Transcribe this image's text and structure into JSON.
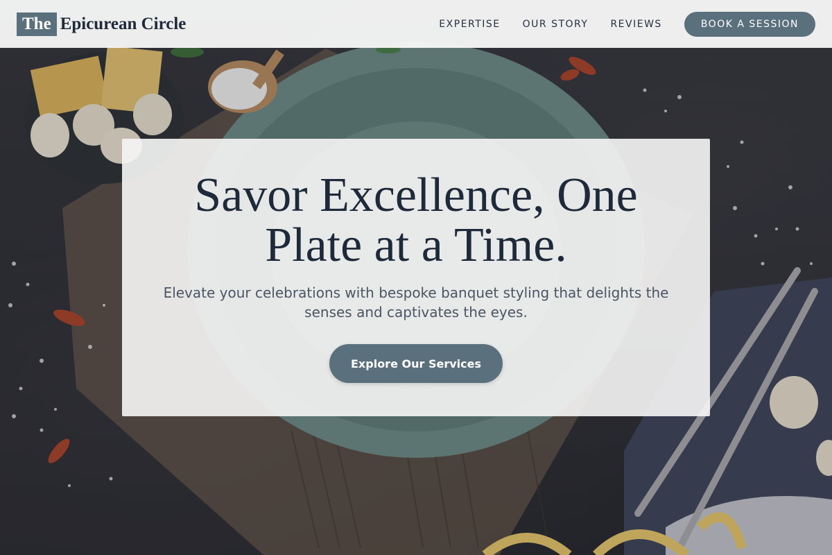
{
  "header": {
    "logo_mark": "The",
    "logo_text": "Epicurean Circle",
    "nav": [
      {
        "label": "EXPERTISE"
      },
      {
        "label": "OUR STORY"
      },
      {
        "label": "REVIEWS"
      }
    ],
    "cta_label": "BOOK A SESSION"
  },
  "hero": {
    "title": "Savor Excellence, One Plate at a Time.",
    "subtitle": "Elevate your celebrations with bespoke banquet styling that delights the senses and captivates the eyes.",
    "button_label": "Explore Our Services",
    "background_image": "food-table-photo"
  },
  "colors": {
    "accent": "#5b707d",
    "heading": "#1e2a3a",
    "body_text": "#4b5563",
    "header_bg": "#f6f6f6"
  }
}
